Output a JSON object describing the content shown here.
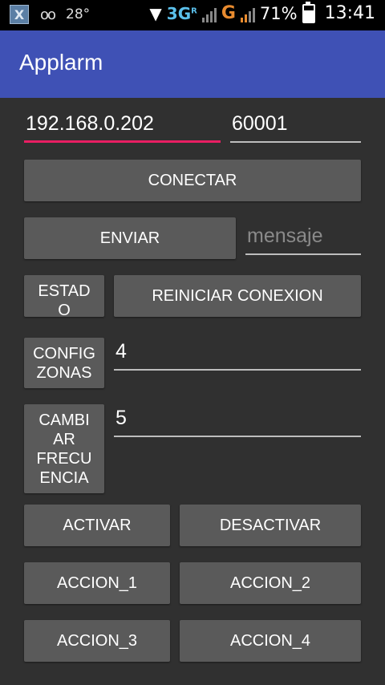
{
  "status_bar": {
    "temperature": "28°",
    "network_3g": "3G",
    "network_3g_sup": "R",
    "network_g": "G",
    "battery": "71%",
    "time": "13:41",
    "icons": [
      "x-app-icon",
      "voicemail-icon",
      "wifi-icon",
      "signal-icon",
      "battery-icon"
    ]
  },
  "app_bar": {
    "title": "Applarm",
    "color": "#3f51b5"
  },
  "connection": {
    "ip_value": "192.168.0.202",
    "port_value": "60001",
    "connect_label": "CONECTAR"
  },
  "message": {
    "send_label": "ENVIAR",
    "placeholder": "mensaje"
  },
  "status_row": {
    "estado_label": "ESTAD\nO",
    "reset_label": "REINICIAR CONEXION"
  },
  "zones": {
    "config_label": "CONFIG\nZONAS",
    "value": "4"
  },
  "frequency": {
    "change_label": "CAMBI\nAR\nFRECU\nENCIA",
    "value": "5"
  },
  "actions": {
    "activate_label": "ACTIVAR",
    "deactivate_label": "DESACTIVAR",
    "action1_label": "ACCION_1",
    "action2_label": "ACCION_2",
    "action3_label": "ACCION_3",
    "action4_label": "ACCION_4"
  },
  "colors": {
    "accent": "#e91e63",
    "background": "#303030",
    "button": "#5a5a5a"
  }
}
